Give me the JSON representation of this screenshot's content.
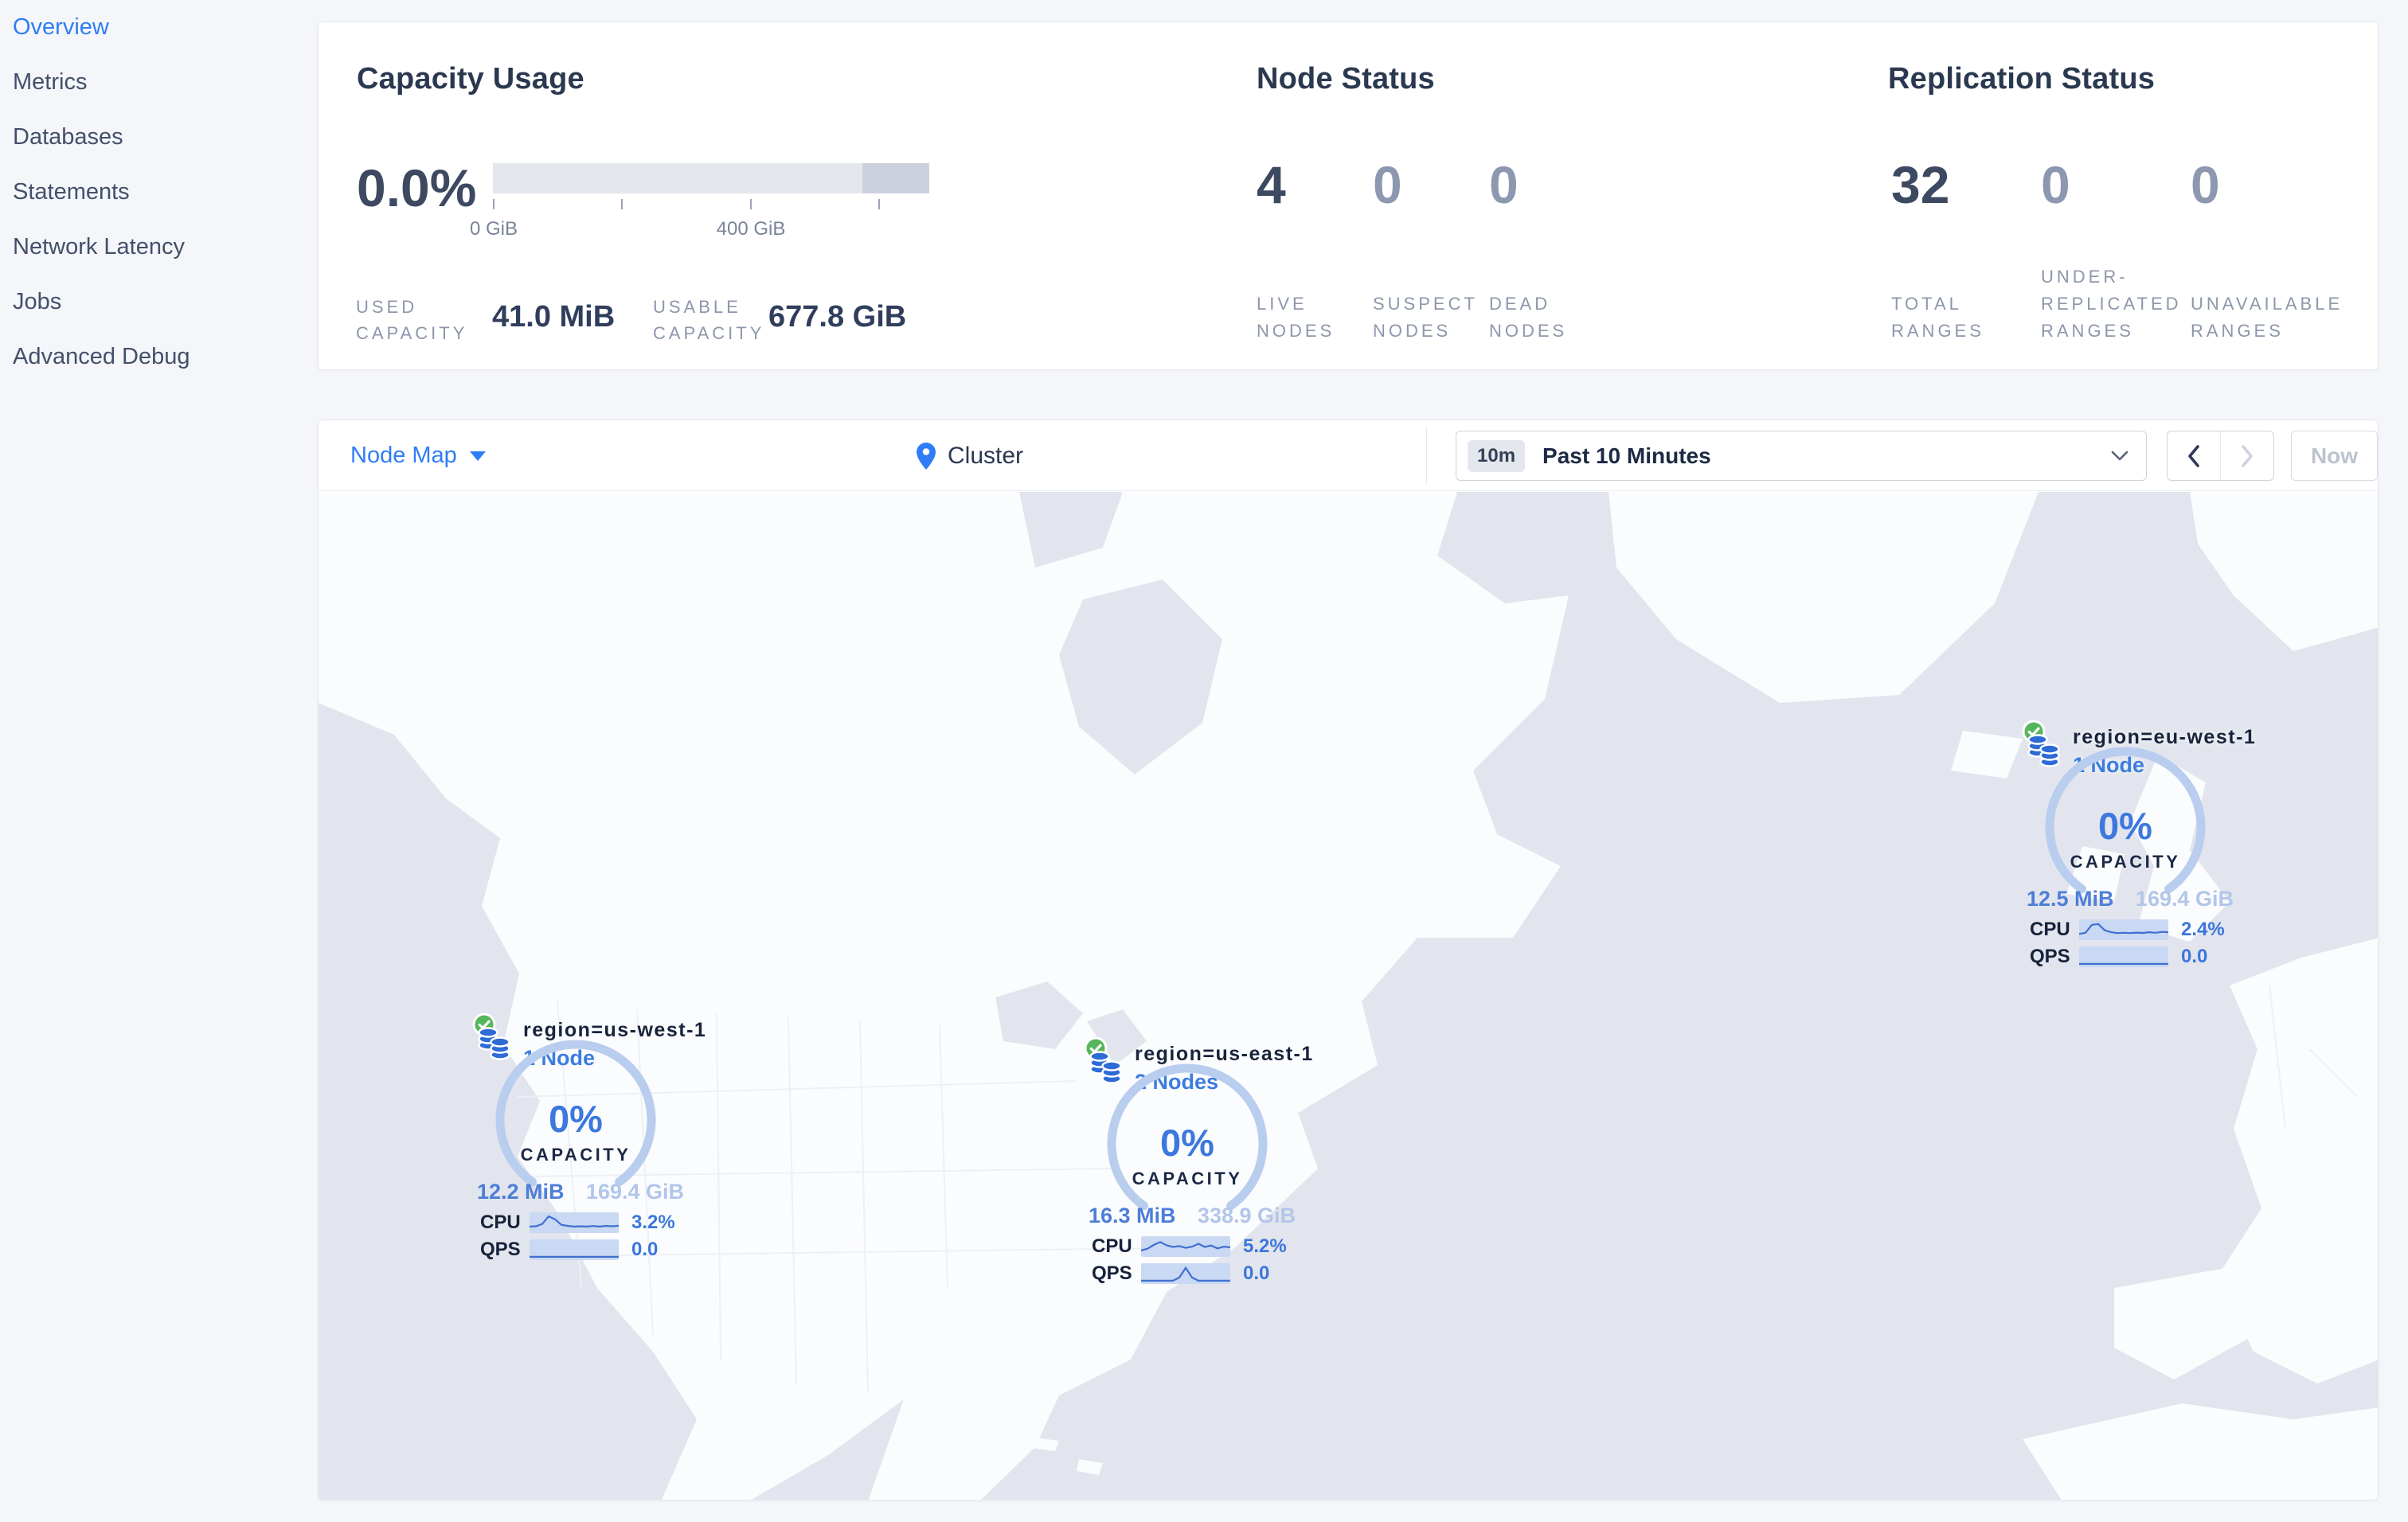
{
  "sidebar": {
    "items": [
      {
        "label": "Overview",
        "active": true
      },
      {
        "label": "Metrics",
        "active": false
      },
      {
        "label": "Databases",
        "active": false
      },
      {
        "label": "Statements",
        "active": false
      },
      {
        "label": "Network Latency",
        "active": false
      },
      {
        "label": "Jobs",
        "active": false
      },
      {
        "label": "Advanced Debug",
        "active": false
      }
    ]
  },
  "summary": {
    "capacity": {
      "title": "Capacity Usage",
      "percent": "0.0%",
      "tick_labels": [
        "0 GiB",
        "400 GiB"
      ],
      "used_label": [
        "USED",
        "CAPACITY"
      ],
      "used_value": "41.0 MiB",
      "usable_label": [
        "USABLE",
        "CAPACITY"
      ],
      "usable_value": "677.8 GiB",
      "bar_used_fraction": 0.0,
      "bar_reserved_fraction": 0.153
    },
    "node_status": {
      "title": "Node Status",
      "stats": [
        {
          "value": "4",
          "label": [
            "LIVE",
            "NODES"
          ],
          "muted": false
        },
        {
          "value": "0",
          "label": [
            "SUSPECT",
            "NODES"
          ],
          "muted": true
        },
        {
          "value": "0",
          "label": [
            "DEAD",
            "NODES"
          ],
          "muted": true
        }
      ]
    },
    "replication_status": {
      "title": "Replication Status",
      "stats": [
        {
          "value": "32",
          "label": [
            "TOTAL",
            "RANGES"
          ],
          "muted": false
        },
        {
          "value": "0",
          "label": [
            "UNDER-",
            "REPLICATED",
            "RANGES"
          ],
          "muted": true
        },
        {
          "value": "0",
          "label": [
            "UNAVAILABLE",
            "RANGES"
          ],
          "muted": true
        }
      ]
    }
  },
  "toolbar": {
    "view_selector": "Node Map",
    "breadcrumb": "Cluster",
    "time_badge": "10m",
    "time_range": "Past 10 Minutes",
    "now_button": "Now"
  },
  "map": {
    "regions": [
      {
        "name": "region=us-west-1",
        "nodes": "1 Node",
        "percent": "0%",
        "capacity_label": "CAPACITY",
        "used": "12.2 MiB",
        "capacity": "169.4 GiB",
        "cpu_label": "CPU",
        "cpu_value": "3.2%",
        "qps_label": "QPS",
        "qps_value": "0.0",
        "cpu_spark": [
          0.3,
          0.32,
          0.45,
          0.88,
          0.72,
          0.4,
          0.34,
          0.3,
          0.32,
          0.3,
          0.33,
          0.3,
          0.34,
          0.32,
          0.35
        ],
        "qps_spark": [
          0.12,
          0.12,
          0.12,
          0.12,
          0.12,
          0.12,
          0.12,
          0.12,
          0.12,
          0.12,
          0.12,
          0.12,
          0.12,
          0.12,
          0.12
        ]
      },
      {
        "name": "region=us-east-1",
        "nodes": "2 Nodes",
        "percent": "0%",
        "capacity_label": "CAPACITY",
        "used": "16.3 MiB",
        "capacity": "338.9 GiB",
        "cpu_label": "CPU",
        "cpu_value": "5.2%",
        "qps_label": "QPS",
        "qps_value": "0.0",
        "cpu_spark": [
          0.3,
          0.4,
          0.62,
          0.78,
          0.6,
          0.5,
          0.55,
          0.45,
          0.52,
          0.68,
          0.5,
          0.58,
          0.42,
          0.52,
          0.48
        ],
        "qps_spark": [
          0.12,
          0.12,
          0.12,
          0.12,
          0.12,
          0.12,
          0.3,
          0.85,
          0.3,
          0.12,
          0.12,
          0.12,
          0.12,
          0.12,
          0.12
        ]
      },
      {
        "name": "region=eu-west-1",
        "nodes": "1 Node",
        "percent": "0%",
        "capacity_label": "CAPACITY",
        "used": "12.5 MiB",
        "capacity": "169.4 GiB",
        "cpu_label": "CPU",
        "cpu_value": "2.4%",
        "qps_label": "QPS",
        "qps_value": "0.0",
        "cpu_spark": [
          0.28,
          0.35,
          0.8,
          0.85,
          0.5,
          0.38,
          0.33,
          0.35,
          0.33,
          0.36,
          0.34,
          0.38,
          0.35,
          0.4,
          0.38
        ],
        "qps_spark": [
          0.12,
          0.12,
          0.12,
          0.12,
          0.12,
          0.12,
          0.12,
          0.12,
          0.12,
          0.12,
          0.12,
          0.12,
          0.12,
          0.12,
          0.12
        ]
      }
    ]
  },
  "colors": {
    "accent_blue": "#2f7df6",
    "marker_blue": "#3b76dd",
    "healthy_green": "#57b65c",
    "ocean": "#e2e5ed",
    "land": "#fbfcfe",
    "bar_light": "#e4e7ee",
    "bar_dark": "#cbd1dc"
  }
}
